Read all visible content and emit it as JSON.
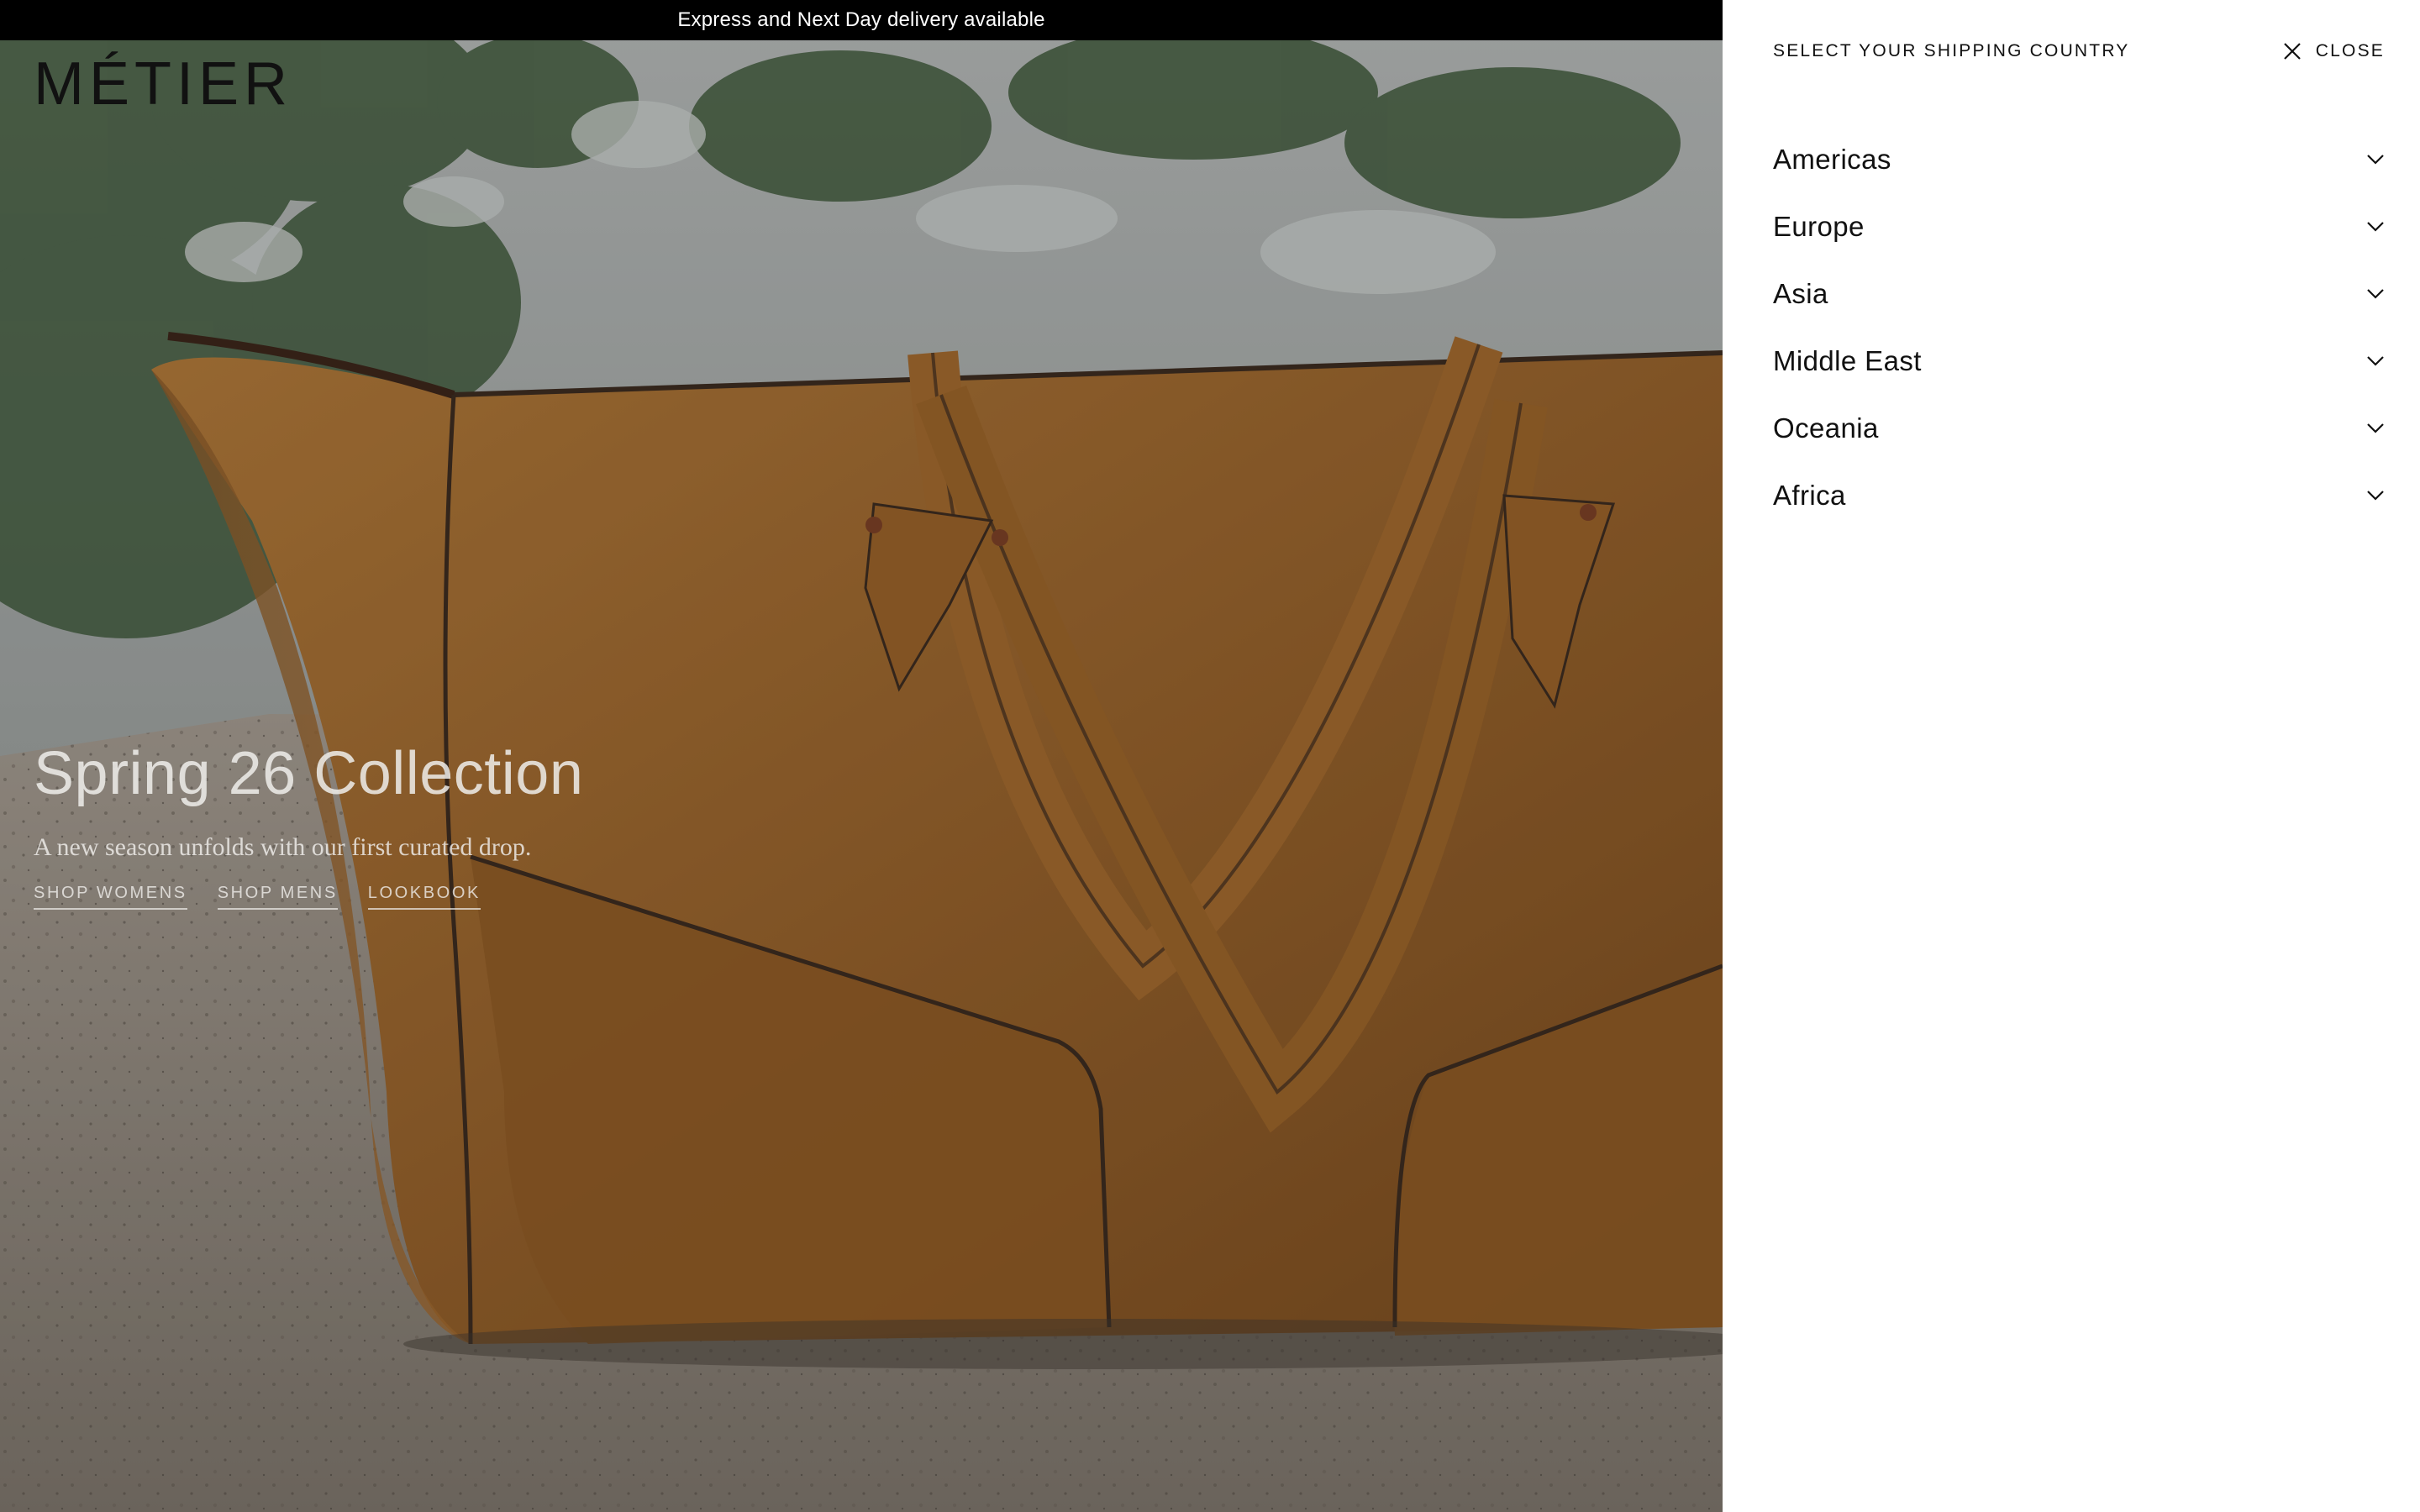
{
  "announcement": {
    "text": "Express and Next Day delivery available"
  },
  "brand": {
    "logo_text": "MÉTIER"
  },
  "hero": {
    "title": "Spring 26 Collection",
    "subtitle": "A new season unfolds with our first curated drop.",
    "links": [
      {
        "label": "SHOP WOMENS"
      },
      {
        "label": "SHOP MENS"
      },
      {
        "label": "LOOKBOOK"
      }
    ]
  },
  "shipping_panel": {
    "title": "SELECT YOUR SHIPPING COUNTRY",
    "close_label": "CLOSE",
    "close_icon": "close-icon",
    "regions": [
      {
        "label": "Americas",
        "icon": "chevron-down-icon"
      },
      {
        "label": "Europe",
        "icon": "chevron-down-icon"
      },
      {
        "label": "Asia",
        "icon": "chevron-down-icon"
      },
      {
        "label": "Middle East",
        "icon": "chevron-down-icon"
      },
      {
        "label": "Oceania",
        "icon": "chevron-down-icon"
      },
      {
        "label": "Africa",
        "icon": "chevron-down-icon"
      }
    ]
  },
  "colors": {
    "announcement_bg": "#000000",
    "panel_bg": "#ffffff",
    "text_dark": "#111111",
    "bag_tan": "#9a6326"
  }
}
